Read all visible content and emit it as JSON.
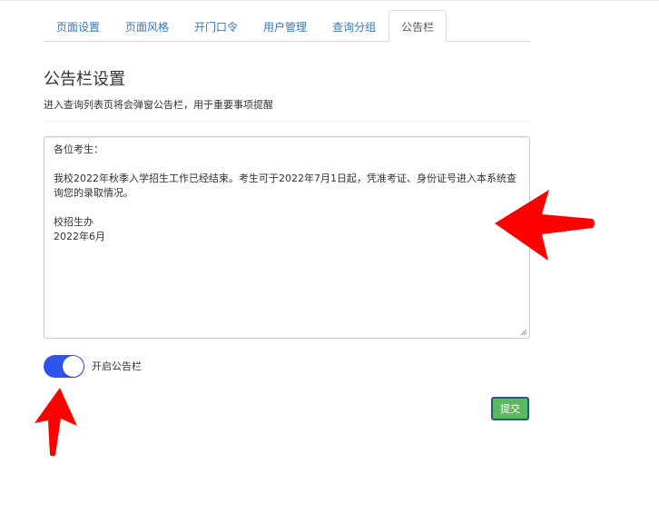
{
  "tabs": [
    {
      "label": "页面设置",
      "active": false
    },
    {
      "label": "页面风格",
      "active": false
    },
    {
      "label": "开门口令",
      "active": false
    },
    {
      "label": "用户管理",
      "active": false
    },
    {
      "label": "查询分组",
      "active": false
    },
    {
      "label": "公告栏",
      "active": true
    }
  ],
  "section": {
    "title": "公告栏设置",
    "description": "进入查询列表页将会弹窗公告栏，用于重要事项提醒"
  },
  "notice": {
    "lines": [
      "各位考生：",
      "",
      "我校2022年秋季入学招生工作已经结束。考生可于2022年7月1日起，凭准考证、身份证号进入本系统查",
      "询您的录取情况。",
      "",
      "校招生办",
      "2022年6月"
    ]
  },
  "toggle": {
    "label": "开启公告栏",
    "on": true,
    "color": "#2f54eb"
  },
  "submit": {
    "label": "提交",
    "color": "#5cb85c"
  },
  "annotations": {
    "arrow_color": "#ff0000"
  }
}
